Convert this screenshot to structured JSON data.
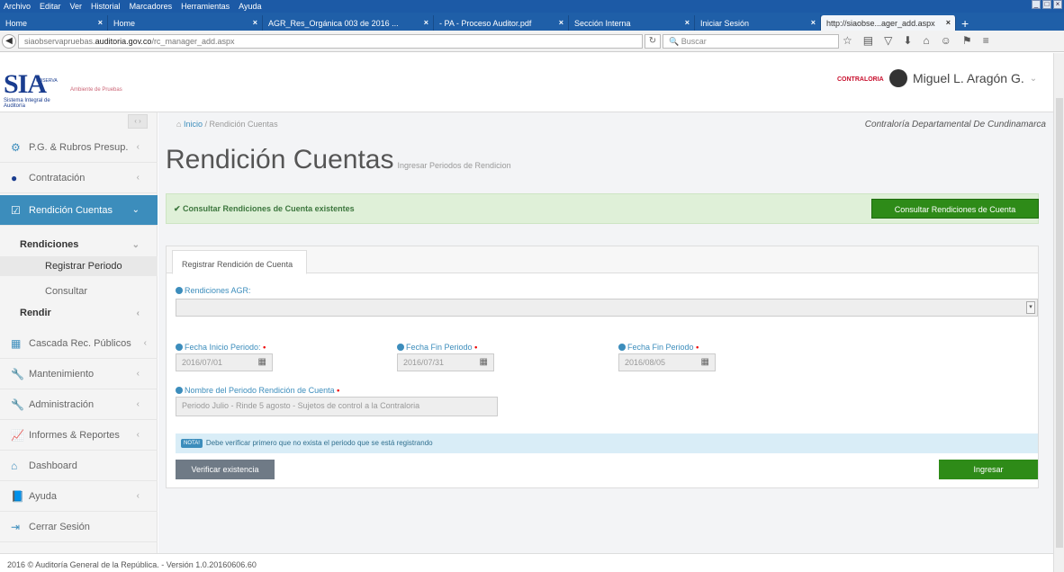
{
  "browser": {
    "menu": [
      "Archivo",
      "Editar",
      "Ver",
      "Historial",
      "Marcadores",
      "Herramientas",
      "Ayuda"
    ],
    "tabs": [
      {
        "label": "Home",
        "active": false
      },
      {
        "label": "Home",
        "active": false
      },
      {
        "label": "AGR_Res_Orgánica 003 de 2016 ...",
        "active": false
      },
      {
        "label": "- PA - Proceso Auditor.pdf",
        "active": false
      },
      {
        "label": "Sección Interna",
        "active": false
      },
      {
        "label": "Iniciar Sesión",
        "active": false
      },
      {
        "label": "http://siaobse...ager_add.aspx",
        "active": true
      }
    ],
    "url_prefix": "siaobservapruebas.",
    "url_domain": "auditoria.gov.co",
    "url_path": "/rc_manager_add.aspx",
    "search_placeholder": "Buscar"
  },
  "header": {
    "logo_text": "SIA",
    "logo_sub": "Sistema Integral de Auditoría",
    "logo_badge": "OBSERVA",
    "ambiente": "Ambiente de Pruebas",
    "contraloria_logo": "CONTRALORIA",
    "user_name": "Miguel L. Aragón G."
  },
  "sidebar": {
    "toggle": "‹ ›",
    "items": [
      {
        "label": "P.G. & Rubros Presup.",
        "icon": "gears-icon"
      },
      {
        "label": "Contratación",
        "icon": "circle-icon"
      },
      {
        "label": "Rendición Cuentas",
        "icon": "check-square-icon",
        "active": true
      },
      {
        "label": "Rendiciones"
      },
      {
        "label": "Registrar Periodo"
      },
      {
        "label": "Consultar"
      },
      {
        "label": "Rendir"
      },
      {
        "label": "Cascada Rec. Públicos",
        "icon": "grid-icon"
      },
      {
        "label": "Mantenimiento",
        "icon": "wrench-icon"
      },
      {
        "label": "Administración",
        "icon": "wrench-icon"
      },
      {
        "label": "Informes & Reportes",
        "icon": "chart-icon"
      },
      {
        "label": "Dashboard",
        "icon": "home-icon"
      },
      {
        "label": "Ayuda",
        "icon": "book-icon"
      },
      {
        "label": "Cerrar Sesión",
        "icon": "logout-icon"
      }
    ]
  },
  "breadcrumb": {
    "home": "Inicio",
    "sep": "/",
    "current": "Rendición Cuentas",
    "entity": "Contraloría Departamental De Cundinamarca"
  },
  "page": {
    "title": "Rendición Cuentas",
    "subtitle": "Ingresar Periodos de Rendicion"
  },
  "alert": {
    "text": "Consultar Rendiciones de Cuenta existentes",
    "button": "Consultar Rendiciones de Cuenta"
  },
  "form": {
    "tab": "Registrar Rendición de Cuenta",
    "rendiciones_label": "Rendiciones AGR:",
    "rendiciones_value": "",
    "fecha_inicio_label": "Fecha Inicio Periodo:",
    "fecha_inicio_value": "2016/07/01",
    "fecha_fin_label": "Fecha Fin Periodo",
    "fecha_fin_value": "2016/07/31",
    "fecha_fin2_label": "Fecha Fin Periodo",
    "fecha_fin2_value": "2016/08/05",
    "nombre_label": "Nombre del Periodo Rendición de Cuenta",
    "nombre_value": "Periodo Julio - Rinde 5 agosto - Sujetos de control a la Contraloria",
    "info_badge": "NOTA!",
    "info_text": "Debe verificar primero que no exista el periodo que se está registrando",
    "verify_button": "Verificar existencia",
    "submit_button": "Ingresar"
  },
  "footer": {
    "text": "2016 © Auditoría General de la República. - Versión 1.0.20160606.60"
  }
}
